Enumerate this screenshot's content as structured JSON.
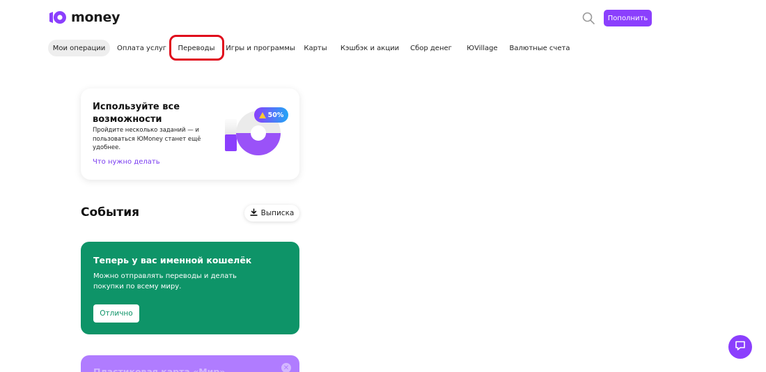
{
  "header": {
    "logo_text": "money",
    "topup_label": "Пополнить",
    "search_icon": "search-icon"
  },
  "nav": {
    "items": [
      {
        "label": "Мои операции",
        "active": true
      },
      {
        "label": "Оплата услуг"
      },
      {
        "label": "Переводы",
        "highlighted": true
      },
      {
        "label": "Игры и программы"
      },
      {
        "label": "Карты"
      },
      {
        "label": "Кэшбэк и акции"
      },
      {
        "label": "Сбор денег"
      },
      {
        "label": "ЮVillage"
      },
      {
        "label": "Валютные счета"
      }
    ]
  },
  "promo": {
    "title": "Используйте все возможности",
    "description": "Пройдите несколько заданий — и пользоваться ЮMoney станет ещё удобнее.",
    "link": "Что нужно делать",
    "progress_badge": "50%",
    "progress": 0.5
  },
  "events": {
    "title": "События",
    "statement_label": "Выписка",
    "statement_icon": "download-icon"
  },
  "green_card": {
    "title": "Теперь у вас именной кошелёк",
    "description": "Можно отправлять переводы и делать покупки по всему миру.",
    "button": "Отлично"
  },
  "purple_card": {
    "title": "Пластиковая карта «Мир»"
  },
  "colors": {
    "accent": "#8b3ffd",
    "green": "#0e9468",
    "highlight": "#e00b1c"
  }
}
